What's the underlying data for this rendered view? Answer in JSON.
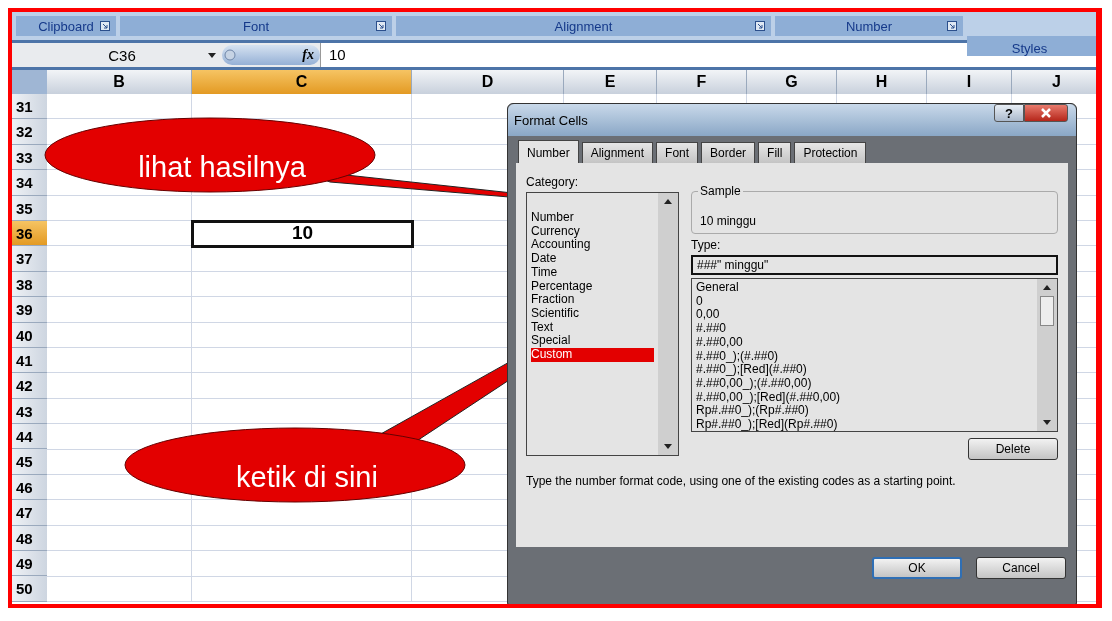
{
  "ribbon": {
    "groups": [
      {
        "label": "Clipboard",
        "launcher": true
      },
      {
        "label": "Font",
        "launcher": true
      },
      {
        "label": "Alignment",
        "launcher": true
      },
      {
        "label": "Number",
        "launcher": true
      },
      {
        "label": "Styles",
        "launcher": false
      }
    ]
  },
  "formula_bar": {
    "name_box": "C36",
    "fx": "fx",
    "value": "10"
  },
  "columns": [
    {
      "label": "B",
      "selected": false
    },
    {
      "label": "C",
      "selected": true
    },
    {
      "label": "D",
      "selected": false
    },
    {
      "label": "E",
      "selected": false
    },
    {
      "label": "F",
      "selected": false
    },
    {
      "label": "G",
      "selected": false
    },
    {
      "label": "H",
      "selected": false
    },
    {
      "label": "I",
      "selected": false
    },
    {
      "label": "J",
      "selected": false
    }
  ],
  "rows": [
    {
      "label": "31",
      "selected": false
    },
    {
      "label": "32",
      "selected": false
    },
    {
      "label": "33",
      "selected": false
    },
    {
      "label": "34",
      "selected": false
    },
    {
      "label": "35",
      "selected": false
    },
    {
      "label": "36",
      "selected": true
    },
    {
      "label": "37",
      "selected": false
    },
    {
      "label": "38",
      "selected": false
    },
    {
      "label": "39",
      "selected": false
    },
    {
      "label": "40",
      "selected": false
    },
    {
      "label": "41",
      "selected": false
    },
    {
      "label": "42",
      "selected": false
    },
    {
      "label": "43",
      "selected": false
    },
    {
      "label": "44",
      "selected": false
    },
    {
      "label": "45",
      "selected": false
    },
    {
      "label": "46",
      "selected": false
    },
    {
      "label": "47",
      "selected": false
    },
    {
      "label": "48",
      "selected": false
    },
    {
      "label": "49",
      "selected": false
    },
    {
      "label": "50",
      "selected": false
    }
  ],
  "active_cell_value": "10",
  "dialog": {
    "title": "Format Cells",
    "help": "?",
    "tabs": [
      {
        "label": "Number",
        "selected": true
      },
      {
        "label": "Alignment",
        "selected": false
      },
      {
        "label": "Font",
        "selected": false
      },
      {
        "label": "Border",
        "selected": false
      },
      {
        "label": "Fill",
        "selected": false
      },
      {
        "label": "Protection",
        "selected": false
      }
    ],
    "category_label": "Category:",
    "categories": [
      {
        "label": "Number",
        "selected": false
      },
      {
        "label": "Currency",
        "selected": false
      },
      {
        "label": "Accounting",
        "selected": false
      },
      {
        "label": "Date",
        "selected": false
      },
      {
        "label": "Time",
        "selected": false
      },
      {
        "label": "Percentage",
        "selected": false
      },
      {
        "label": "Fraction",
        "selected": false
      },
      {
        "label": "Scientific",
        "selected": false
      },
      {
        "label": "Text",
        "selected": false
      },
      {
        "label": "Special",
        "selected": false
      },
      {
        "label": "Custom",
        "selected": true
      }
    ],
    "sample": {
      "legend": "Sample",
      "value": "10 minggu"
    },
    "type_label": "Type:",
    "type_value": "###\" minggu\"",
    "formats": [
      "General",
      "0",
      "0,00",
      "#.##0",
      "#.##0,00",
      "#.##0_);(#.##0)",
      "#.##0_);[Red](#.##0)",
      "#.##0,00_);(#.##0,00)",
      "#.##0,00_);[Red](#.##0,00)",
      "Rp#.##0_);(Rp#.##0)",
      "Rp#.##0_);[Red](Rp#.##0)"
    ],
    "delete_button": "Delete",
    "description": "Type the number format code, using one of the existing codes as a starting point.",
    "buttons": [
      {
        "label": "OK",
        "default": true
      },
      {
        "label": "Cancel",
        "default": false
      }
    ]
  },
  "callouts": [
    {
      "text": "lihat hasilnya"
    },
    {
      "text": "ketik di sini"
    }
  ]
}
